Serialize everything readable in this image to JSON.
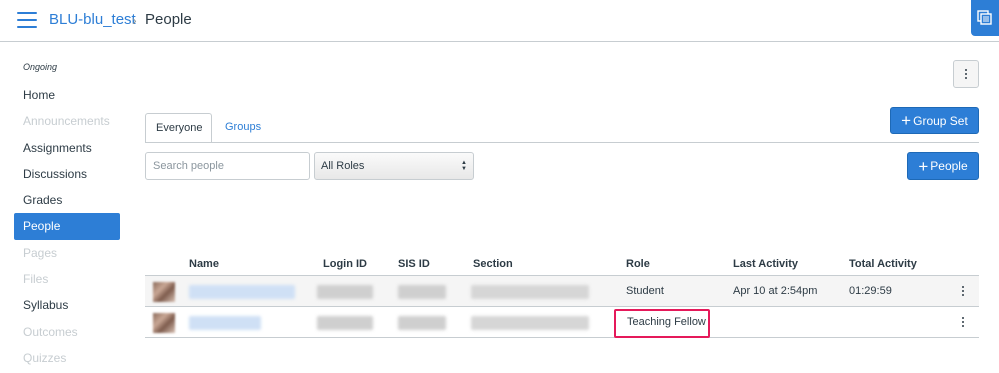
{
  "header": {
    "course": "BLU-blu_test",
    "separator": "›",
    "page": "People"
  },
  "sidebar": {
    "term": "Ongoing",
    "items": [
      {
        "label": "Home",
        "state": "normal"
      },
      {
        "label": "Announcements",
        "state": "disabled"
      },
      {
        "label": "Assignments",
        "state": "normal"
      },
      {
        "label": "Discussions",
        "state": "normal"
      },
      {
        "label": "Grades",
        "state": "normal"
      },
      {
        "label": "People",
        "state": "active"
      },
      {
        "label": "Pages",
        "state": "disabled"
      },
      {
        "label": "Files",
        "state": "disabled"
      },
      {
        "label": "Syllabus",
        "state": "normal"
      },
      {
        "label": "Outcomes",
        "state": "disabled"
      },
      {
        "label": "Quizzes",
        "state": "disabled"
      }
    ]
  },
  "tabs": {
    "everyone": "Everyone",
    "groups": "Groups"
  },
  "actions": {
    "group_set": "Group Set",
    "people": "People",
    "plus": "+"
  },
  "filters": {
    "search_placeholder": "Search people",
    "role_selected": "All Roles"
  },
  "table": {
    "headers": [
      "Name",
      "Login ID",
      "SIS ID",
      "Section",
      "Role",
      "Last Activity",
      "Total Activity"
    ],
    "rows": [
      {
        "role": "Student",
        "last_activity": "Apr 10 at 2:54pm",
        "total_activity": "01:29:59"
      },
      {
        "role": "Teaching Fellow",
        "last_activity": "",
        "total_activity": ""
      }
    ]
  },
  "colors": {
    "accent": "#2d7ed6",
    "highlight": "#e5195a",
    "text": "#2d3b45",
    "border": "#c7cdd1"
  },
  "icons": {
    "menu": "hamburger-icon",
    "tray": "tray-icon",
    "more": "kebab-icon",
    "select": "sort-arrows-icon"
  }
}
